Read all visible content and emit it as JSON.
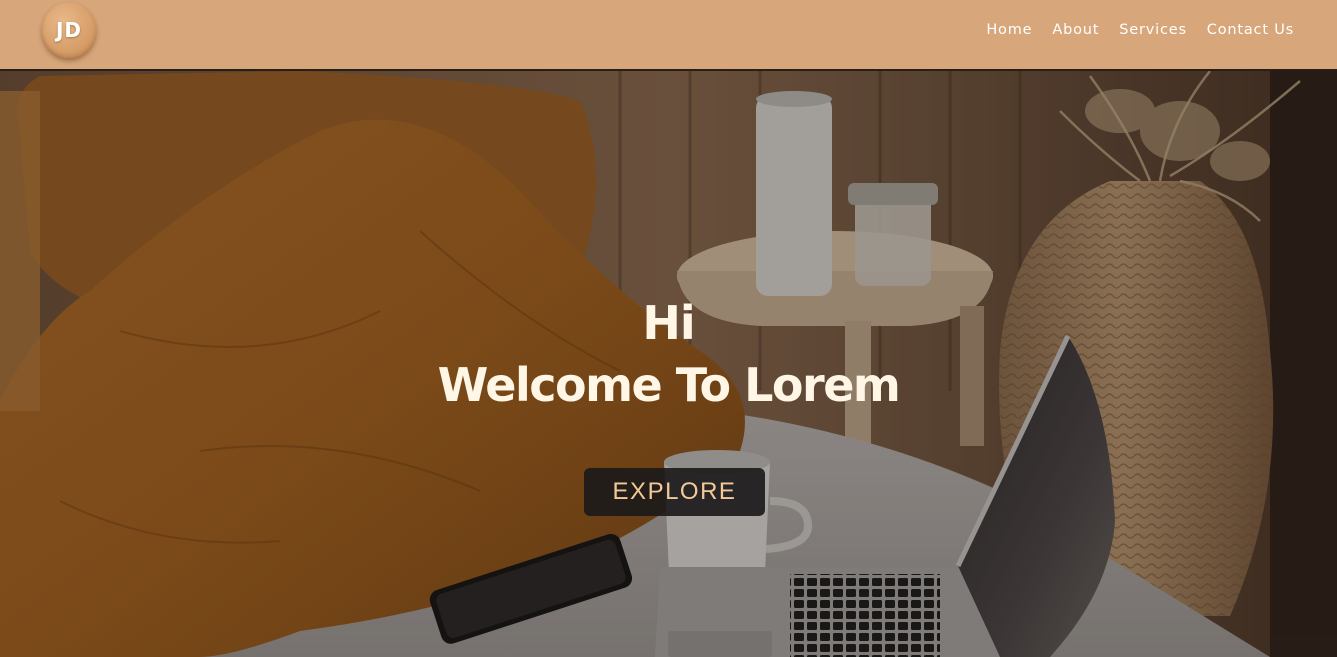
{
  "header": {
    "logo_text": "JD",
    "nav": [
      {
        "label": "Home"
      },
      {
        "label": "About"
      },
      {
        "label": "Services"
      },
      {
        "label": "Contact Us"
      }
    ]
  },
  "hero": {
    "greeting": "Hi",
    "headline": "Welcome To Lorem",
    "cta_label": "EXPLORE"
  },
  "colors": {
    "navbar_bg": "#d7a67a",
    "cta_text": "#f4c99a",
    "hero_text": "#fff6e6"
  }
}
